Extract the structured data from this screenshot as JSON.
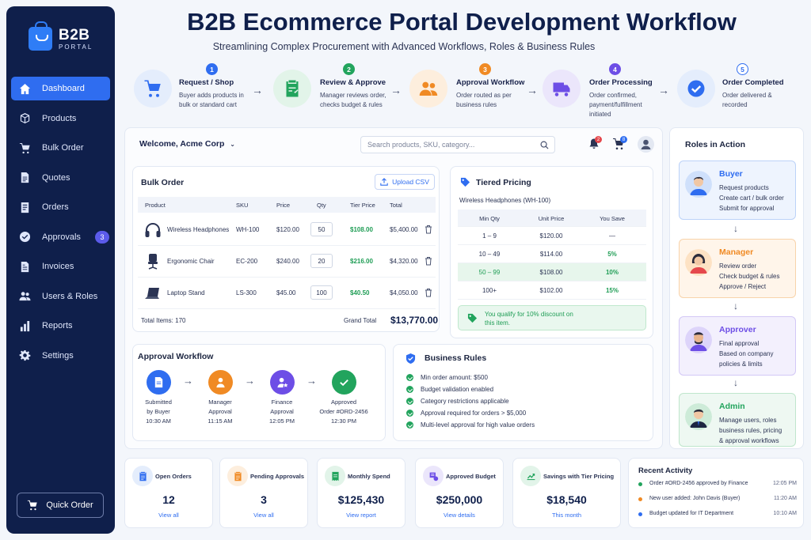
{
  "app": {
    "title": "B2B Ecommerce Portal Development Workflow",
    "subtitle": "Streamlining Complex Procurement with Advanced Workflows, Roles & Business Rules",
    "logo_title": "B2B",
    "logo_sub": "PORTAL"
  },
  "sidebar": {
    "items": [
      {
        "label": "Dashboard",
        "icon": "home-icon"
      },
      {
        "label": "Products",
        "icon": "box-icon"
      },
      {
        "label": "Bulk Order",
        "icon": "cart-icon"
      },
      {
        "label": "Quotes",
        "icon": "document-icon"
      },
      {
        "label": "Orders",
        "icon": "list-icon"
      },
      {
        "label": "Approvals",
        "icon": "check-circle-icon",
        "badge": "3"
      },
      {
        "label": "Invoices",
        "icon": "invoice-icon"
      },
      {
        "label": "Users & Roles",
        "icon": "users-icon"
      },
      {
        "label": "Reports",
        "icon": "bar-chart-icon"
      },
      {
        "label": "Settings",
        "icon": "gear-icon"
      }
    ],
    "quick_order": "Quick Order"
  },
  "workflow": [
    {
      "num": "1",
      "title": "Request / Shop",
      "desc": "Buyer adds products in bulk or standard cart",
      "color": "#2f6df0",
      "bg": "#e4edfc"
    },
    {
      "num": "2",
      "title": "Review & Approve",
      "desc": "Manager reviews order, checks budget & rules",
      "color": "#22a45d",
      "bg": "#e2f4e9"
    },
    {
      "num": "3",
      "title": "Approval Workflow",
      "desc": "Order routed as per business rules",
      "color": "#f08a24",
      "bg": "#fdeedd"
    },
    {
      "num": "4",
      "title": "Order Processing",
      "desc": "Order confirmed, payment/fulfillment initiated",
      "color": "#6d4ee6",
      "bg": "#ebe6fb"
    },
    {
      "num": "5",
      "title": "Order Completed",
      "desc": "Order delivered & recorded",
      "color": "#2f6df0",
      "bg": "#e4edfc"
    }
  ],
  "header": {
    "welcome": "Welcome, Acme Corp",
    "search_placeholder": "Search products, SKU, category...",
    "notif_count": "2",
    "cart_count": "8"
  },
  "bulk_order": {
    "title": "Bulk Order",
    "upload_label": "Upload CSV",
    "columns": [
      "Product",
      "SKU",
      "Price",
      "Qty",
      "Tier Price",
      "Total"
    ],
    "rows": [
      {
        "product": "Wireless Headphones",
        "sku": "WH-100",
        "price": "$120.00",
        "qty": "50",
        "tier": "$108.00",
        "total": "$5,400.00",
        "icon": "headphones-icon"
      },
      {
        "product": "Ergonomic Chair",
        "sku": "EC-200",
        "price": "$240.00",
        "qty": "20",
        "tier": "$216.00",
        "total": "$4,320.00",
        "icon": "chair-icon"
      },
      {
        "product": "Laptop Stand",
        "sku": "LS-300",
        "price": "$45.00",
        "qty": "100",
        "tier": "$40.50",
        "total": "$4,050.00",
        "icon": "laptop-icon"
      }
    ],
    "total_items": "Total Items: 170",
    "grand_total_label": "Grand Total",
    "grand_total": "$13,770.00"
  },
  "tiered": {
    "title": "Tiered Pricing",
    "product": "Wireless Headphones (WH-100)",
    "columns": [
      "Min Qty",
      "Unit Price",
      "You Save"
    ],
    "rows": [
      {
        "qty": "1 – 9",
        "price": "$120.00",
        "save": "—"
      },
      {
        "qty": "10 – 49",
        "price": "$114.00",
        "save": "5%"
      },
      {
        "qty": "50 – 99",
        "price": "$108.00",
        "save": "10%"
      },
      {
        "qty": "100+",
        "price": "$102.00",
        "save": "15%"
      }
    ],
    "qualify_1": "You qualify for 10% discount on",
    "qualify_2": "this item."
  },
  "approval": {
    "title": "Approval Workflow",
    "steps": [
      {
        "l1": "Submitted",
        "l2": "by Buyer",
        "time": "10:30 AM",
        "color": "#2f6df0"
      },
      {
        "l1": "Manager",
        "l2": "Approval",
        "time": "11:15 AM",
        "color": "#f08a24"
      },
      {
        "l1": "Finance",
        "l2": "Approval",
        "time": "12:05 PM",
        "color": "#6d4ee6"
      },
      {
        "l1": "Approved",
        "l2": "Order #ORD-2456",
        "time": "12:30 PM",
        "color": "#22a45d"
      }
    ]
  },
  "rules": {
    "title": "Business Rules",
    "items": [
      "Min order amount: $500",
      "Budget validation enabled",
      "Category restrictions applicable",
      "Approval required for orders > $5,000",
      "Multi-level approval for high value orders"
    ]
  },
  "roles": {
    "title": "Roles in Action",
    "items": [
      {
        "name": "Buyer",
        "desc": [
          "Request products",
          "Create cart / bulk order",
          "Submit for approval"
        ],
        "color": "#2f6df0",
        "bg": "#eef4fe",
        "border": "#bcd2f8"
      },
      {
        "name": "Manager",
        "desc": [
          "Review order",
          "Check budget & rules",
          "Approve / Reject"
        ],
        "color": "#f08a24",
        "bg": "#fff5ea",
        "border": "#f8d3aa"
      },
      {
        "name": "Approver",
        "desc": [
          "Final approval",
          "Based on company",
          "policies & limits"
        ],
        "color": "#6d4ee6",
        "bg": "#f3f0fd",
        "border": "#d3c8f6"
      },
      {
        "name": "Admin",
        "desc": [
          "Manage users, roles",
          "business rules, pricing",
          "& approval workflows"
        ],
        "color": "#22a45d",
        "bg": "#eef8f2",
        "border": "#bfe6cc"
      }
    ]
  },
  "stats": [
    {
      "label": "Open Orders",
      "value": "12",
      "link": "View all",
      "color": "#2f6df0",
      "bg": "#e4edfc"
    },
    {
      "label": "Pending Approvals",
      "value": "3",
      "link": "View all",
      "color": "#f08a24",
      "bg": "#fdeedd"
    },
    {
      "label": "Monthly Spend",
      "value": "$125,430",
      "link": "View report",
      "color": "#22a45d",
      "bg": "#e2f4e9"
    },
    {
      "label": "Approved Budget",
      "value": "$250,000",
      "link": "View details",
      "color": "#6d4ee6",
      "bg": "#ebe6fb"
    },
    {
      "label": "Savings with Tier Pricing",
      "value": "$18,540",
      "link": "This month",
      "color": "#22a45d",
      "bg": "#e2f4e9"
    }
  ],
  "activity": {
    "title": "Recent Activity",
    "items": [
      {
        "text": "Order #ORD-2456 approved by Finance",
        "time": "12:05 PM",
        "color": "#22a45d"
      },
      {
        "text": "New user added: John Davis (Buyer)",
        "time": "11:20 AM",
        "color": "#f08a24"
      },
      {
        "text": "Budget updated for IT Department",
        "time": "10:10 AM",
        "color": "#2f6df0"
      }
    ]
  }
}
